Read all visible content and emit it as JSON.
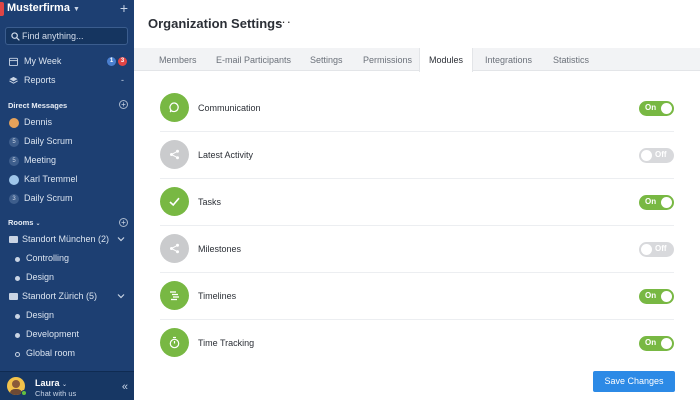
{
  "colors": {
    "sidebar_bg": "#1d3f72",
    "module_on": "#78b843",
    "module_off": "#cacbcd",
    "primary": "#2c8ae6",
    "badge_blue": "#4a7fcf",
    "badge_red": "#e04545"
  },
  "sidebar": {
    "org_name": "Musterfirma",
    "search_placeholder": "Find anything...",
    "nav": [
      {
        "label": "My Week",
        "icon": "calendar-icon",
        "badges": [
          "1",
          "3"
        ]
      },
      {
        "label": "Reports",
        "icon": "layers-icon"
      }
    ],
    "direct_messages_title": "Direct Messages",
    "direct_messages": [
      {
        "label": "Dennis",
        "icon": "avatar-photo"
      },
      {
        "label": "Daily Scrum",
        "icon": "group-number",
        "num": "5"
      },
      {
        "label": "Meeting",
        "icon": "group-number",
        "num": "5"
      },
      {
        "label": "Karl Tremmel",
        "icon": "avatar-photo"
      },
      {
        "label": "Daily Scrum",
        "icon": "group-number",
        "num": "3"
      }
    ],
    "rooms_title": "Rooms",
    "rooms": [
      {
        "label": "Standort München (2)",
        "type": "folder"
      },
      {
        "label": "Controlling",
        "type": "room"
      },
      {
        "label": "Design",
        "type": "room"
      },
      {
        "label": "Standort Zürich (5)",
        "type": "folder"
      },
      {
        "label": "Design",
        "type": "room"
      },
      {
        "label": "Development",
        "type": "room"
      },
      {
        "label": "Global room",
        "type": "room-ring"
      }
    ],
    "user": {
      "name": "Laura",
      "status": "Chat with us"
    }
  },
  "main": {
    "title": "Organization Settings",
    "more_label": "···",
    "tabs": [
      "Members",
      "E-mail Participants",
      "Settings",
      "Permissions",
      "Modules",
      "Integrations",
      "Statistics"
    ],
    "active_tab": "Modules",
    "modules": [
      {
        "label": "Communication",
        "icon": "chat-bubble-icon",
        "enabled": true,
        "toggle_label": "On"
      },
      {
        "label": "Latest Activity",
        "icon": "share-icon",
        "enabled": false,
        "toggle_label": "Off"
      },
      {
        "label": "Tasks",
        "icon": "checkmark-icon",
        "enabled": true,
        "toggle_label": "On"
      },
      {
        "label": "Milestones",
        "icon": "share-icon",
        "enabled": false,
        "toggle_label": "Off"
      },
      {
        "label": "Timelines",
        "icon": "timeline-icon",
        "enabled": true,
        "toggle_label": "On"
      },
      {
        "label": "Time Tracking",
        "icon": "stopwatch-icon",
        "enabled": true,
        "toggle_label": "On"
      }
    ],
    "save_label": "Save Changes"
  }
}
